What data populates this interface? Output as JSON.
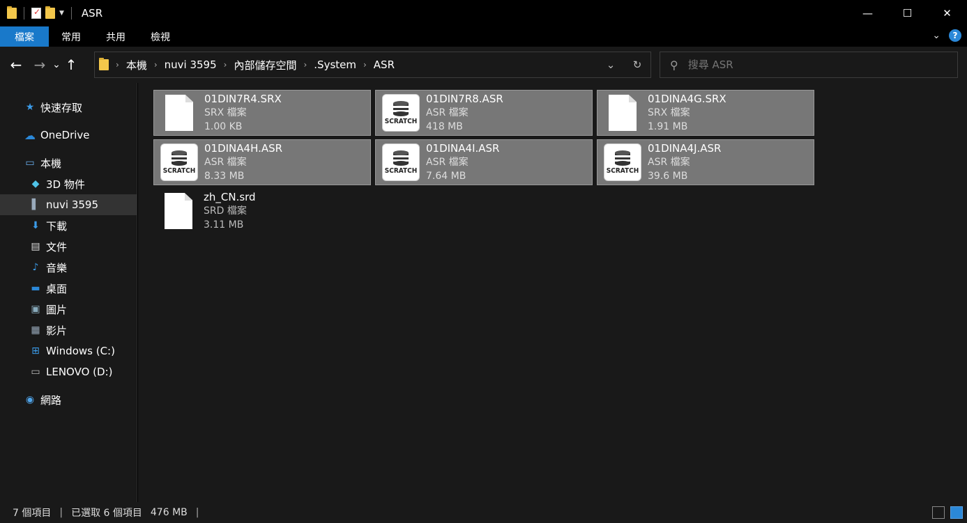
{
  "window": {
    "title": "ASR",
    "controls": {
      "minimize": "—",
      "maximize": "☐",
      "close": "✕"
    }
  },
  "ribbon": {
    "tabs": [
      "檔案",
      "常用",
      "共用",
      "檢視"
    ],
    "help": "?",
    "expand": "⌄"
  },
  "nav": {
    "back": "←",
    "forward": "→",
    "recent": "⌄",
    "up": "↑",
    "breadcrumbs": [
      "本機",
      "nuvi 3595",
      "內部儲存空間",
      ".System",
      "ASR"
    ],
    "refresh": "↻",
    "history": "⌄"
  },
  "search": {
    "placeholder": "搜尋 ASR",
    "icon": "search-icon"
  },
  "sidebar": {
    "quick_access": "快速存取",
    "onedrive": "OneDrive",
    "this_pc": "本機",
    "items": [
      {
        "label": "3D 物件",
        "icon": "cube-icon"
      },
      {
        "label": "nuvi 3595",
        "icon": "device-icon"
      },
      {
        "label": "下載",
        "icon": "download-icon"
      },
      {
        "label": "文件",
        "icon": "document-icon"
      },
      {
        "label": "音樂",
        "icon": "music-icon"
      },
      {
        "label": "桌面",
        "icon": "desktop-icon"
      },
      {
        "label": "圖片",
        "icon": "picture-icon"
      },
      {
        "label": "影片",
        "icon": "video-icon"
      },
      {
        "label": "Windows (C:)",
        "icon": "drive-icon"
      },
      {
        "label": "LENOVO (D:)",
        "icon": "drive-icon"
      }
    ],
    "network": "網路"
  },
  "files": [
    {
      "name": "01DIN7R4.SRX",
      "type": "SRX 檔案",
      "size": "1.00 KB",
      "icon": "blank-file-icon",
      "selected": true
    },
    {
      "name": "01DIN7R8.ASR",
      "type": "ASR 檔案",
      "size": "418 MB",
      "icon": "scratch-icon",
      "selected": true
    },
    {
      "name": "01DINA4G.SRX",
      "type": "SRX 檔案",
      "size": "1.91 MB",
      "icon": "blank-file-icon",
      "selected": true
    },
    {
      "name": "01DINA4H.ASR",
      "type": "ASR 檔案",
      "size": "8.33 MB",
      "icon": "scratch-icon",
      "selected": true
    },
    {
      "name": "01DINA4I.ASR",
      "type": "ASR 檔案",
      "size": "7.64 MB",
      "icon": "scratch-icon",
      "selected": true
    },
    {
      "name": "01DINA4J.ASR",
      "type": "ASR 檔案",
      "size": "39.6 MB",
      "icon": "scratch-icon",
      "selected": true
    },
    {
      "name": "zh_CN.srd",
      "type": "SRD 檔案",
      "size": "3.11 MB",
      "icon": "blank-file-icon",
      "selected": false
    }
  ],
  "scratch_label": "SCRATCH",
  "status": {
    "count": "7 個項目",
    "selected": "已選取 6 個項目",
    "size": "476 MB",
    "sep": "|"
  }
}
